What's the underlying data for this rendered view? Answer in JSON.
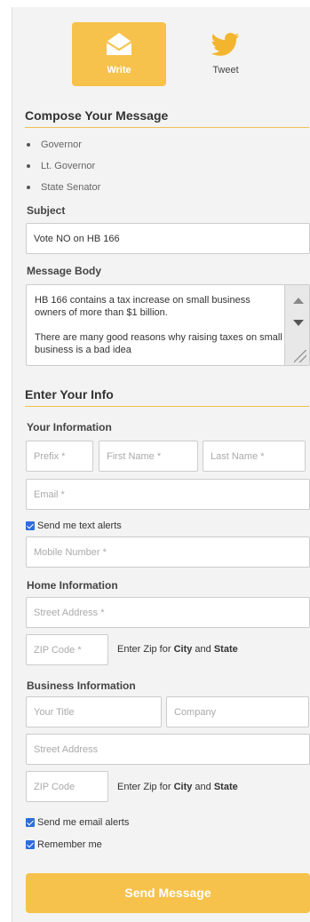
{
  "modes": {
    "write_label": "Write",
    "tweet_label": "Tweet"
  },
  "compose": {
    "title": "Compose Your Message",
    "recipients": [
      "Governor",
      "Lt. Governor",
      "State Senator"
    ],
    "subject_label": "Subject",
    "subject_value": "Vote NO on HB 166",
    "body_label": "Message Body",
    "body_paragraph_1": "HB 166 contains a tax increase on small business owners of more than $1 billion.",
    "body_paragraph_2": "There are many good reasons why raising taxes on small business is a bad idea"
  },
  "info": {
    "title": "Enter Your Info",
    "your_info_label": "Your Information",
    "prefix_placeholder": "Prefix *",
    "first_name_placeholder": "First Name *",
    "last_name_placeholder": "Last Name *",
    "email_placeholder": "Email *",
    "text_alerts_label": "Send me text alerts",
    "mobile_placeholder": "Mobile Number *",
    "home_label": "Home Information",
    "home_street_placeholder": "Street Address *",
    "home_zip_placeholder": "ZIP Code *",
    "zip_hint_prefix": "Enter Zip for ",
    "zip_hint_city": "City",
    "zip_hint_and": " and ",
    "zip_hint_state": "State",
    "business_label": "Business Information",
    "title_placeholder": "Your Title",
    "company_placeholder": "Company",
    "business_street_placeholder": "Street Address",
    "business_zip_placeholder": "ZIP Code",
    "email_alerts_label": "Send me email alerts",
    "remember_label": "Remember me"
  },
  "submit": {
    "label": "Send Message"
  },
  "colors": {
    "accent": "#f6c24c",
    "checkbox": "#2a6fdb"
  }
}
